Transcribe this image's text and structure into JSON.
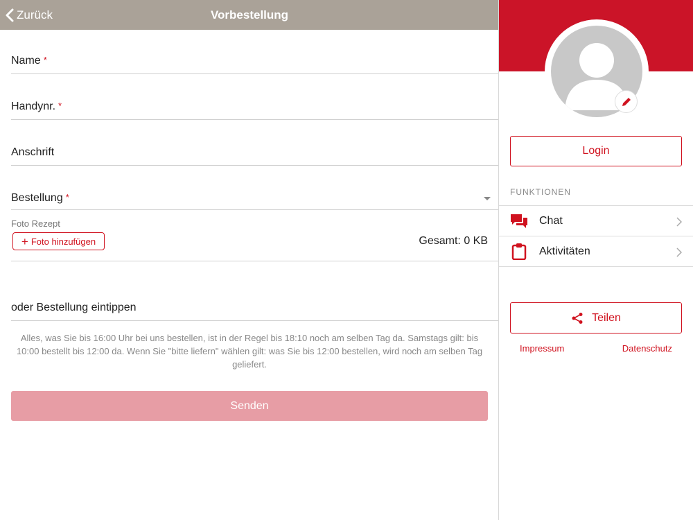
{
  "nav": {
    "back_label": "Zurück",
    "title": "Vorbestellung"
  },
  "form": {
    "name_label": "Name",
    "phone_label": "Handynr.",
    "address_label": "Anschrift",
    "order_label": "Bestellung",
    "required_mark": "*",
    "photo_label": "Foto Rezept",
    "add_photo_label": "Foto hinzufügen",
    "total_label": "Gesamt: 0 KB",
    "type_label": "oder Bestellung eintippen",
    "info_text": "Alles, was Sie bis 16:00 Uhr bei uns bestellen, ist in der Regel bis 18:10 noch am selben Tag da. Samstags gilt: bis 10:00 bestellt bis 12:00 da. Wenn Sie \"bitte liefern\" wählen gilt: was Sie bis 12:00 bestellen, wird noch am selben Tag geliefert.",
    "send_label": "Senden"
  },
  "sidebar": {
    "login_label": "Login",
    "section_header": "FUNKTIONEN",
    "items": [
      {
        "label": "Chat",
        "icon": "chat-icon"
      },
      {
        "label": "Aktivitäten",
        "icon": "clipboard-icon"
      }
    ],
    "share_label": "Teilen",
    "impressum_label": "Impressum",
    "datenschutz_label": "Datenschutz"
  },
  "colors": {
    "accent": "#d0121f",
    "navbar": "#aaa298",
    "banner": "#cb1428",
    "send_disabled": "#e79da5"
  }
}
